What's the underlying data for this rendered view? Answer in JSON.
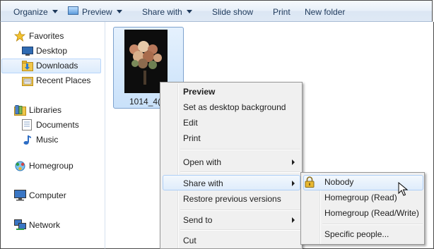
{
  "toolbar": {
    "organize_label": "Organize",
    "preview_label": "Preview",
    "share_label": "Share with",
    "slideshow_label": "Slide show",
    "print_label": "Print",
    "newfolder_label": "New folder"
  },
  "nav": {
    "favorites": "Favorites",
    "desktop": "Desktop",
    "downloads": "Downloads",
    "recent": "Recent Places",
    "libraries": "Libraries",
    "documents": "Documents",
    "music": "Music",
    "homegroup": "Homegroup",
    "computer": "Computer",
    "network": "Network",
    "selected": "Downloads"
  },
  "file": {
    "caption": "1014_4("
  },
  "context_menu": {
    "preview": "Preview",
    "set_background": "Set as desktop background",
    "edit": "Edit",
    "print": "Print",
    "open_with": "Open with",
    "share_with": "Share with",
    "restore": "Restore previous versions",
    "send_to": "Send to",
    "cut": "Cut"
  },
  "share_submenu": {
    "nobody": "Nobody",
    "homegroup_read": "Homegroup (Read)",
    "homegroup_readwrite": "Homegroup (Read/Write)",
    "specific": "Specific people..."
  },
  "colors": {
    "toolbar_text": "#1e395b",
    "highlight_border": "#aecff7",
    "menu_bg": "#f0f0f0"
  }
}
